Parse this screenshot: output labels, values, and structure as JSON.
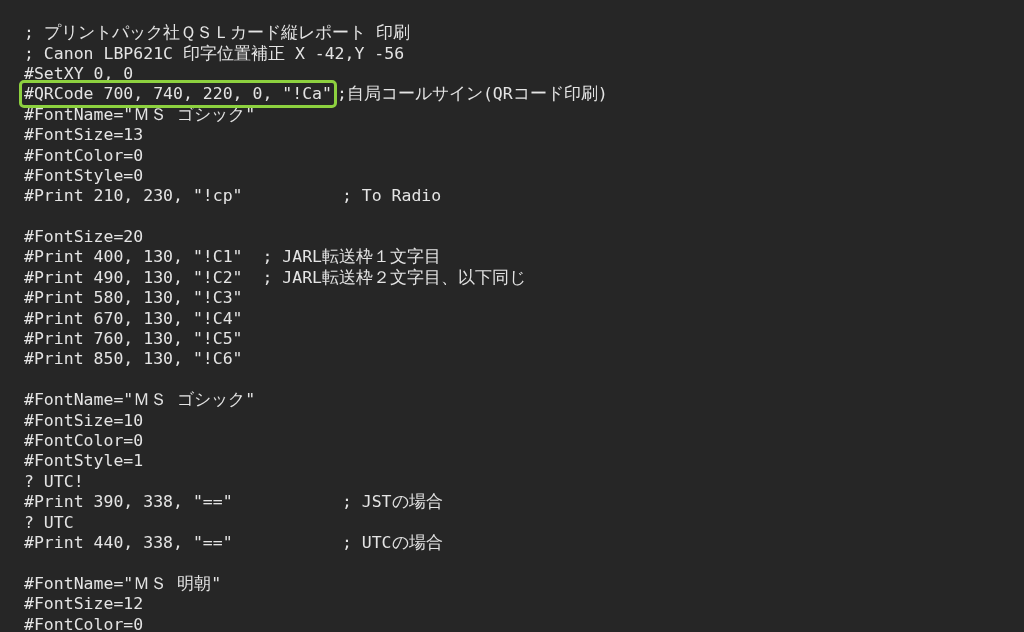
{
  "editor": {
    "lines": [
      {
        "kind": "code",
        "text": "; プリントパック社ＱＳＬカード縦レポート 印刷"
      },
      {
        "kind": "code",
        "text": "; Canon LBP621C 印字位置補正 X -42,Y -56"
      },
      {
        "kind": "code",
        "text": "#SetXY 0, 0"
      },
      {
        "kind": "boxed",
        "text": "#QRCode 700, 740, 220, 0, \"!Ca\"",
        "comment": ";自局コールサイン(QRコード印刷)"
      },
      {
        "kind": "code",
        "text": "#FontName=\"ＭＳ ゴシック\""
      },
      {
        "kind": "code",
        "text": "#FontSize=13"
      },
      {
        "kind": "code",
        "text": "#FontColor=0"
      },
      {
        "kind": "code",
        "text": "#FontStyle=0"
      },
      {
        "kind": "code",
        "text": "#Print 210, 230, \"!cp\"          ; To Radio"
      },
      {
        "kind": "blank"
      },
      {
        "kind": "code",
        "text": "#FontSize=20"
      },
      {
        "kind": "code",
        "text": "#Print 400, 130, \"!C1\"  ; JARL転送枠１文字目"
      },
      {
        "kind": "code",
        "text": "#Print 490, 130, \"!C2\"  ; JARL転送枠２文字目、以下同じ"
      },
      {
        "kind": "code",
        "text": "#Print 580, 130, \"!C3\""
      },
      {
        "kind": "code",
        "text": "#Print 670, 130, \"!C4\""
      },
      {
        "kind": "code",
        "text": "#Print 760, 130, \"!C5\""
      },
      {
        "kind": "code",
        "text": "#Print 850, 130, \"!C6\""
      },
      {
        "kind": "blank"
      },
      {
        "kind": "code",
        "text": "#FontName=\"ＭＳ ゴシック\""
      },
      {
        "kind": "code",
        "text": "#FontSize=10"
      },
      {
        "kind": "code",
        "text": "#FontColor=0"
      },
      {
        "kind": "code",
        "text": "#FontStyle=1"
      },
      {
        "kind": "code",
        "text": "? UTC!"
      },
      {
        "kind": "code",
        "text": "#Print 390, 338, \"==\"           ; JSTの場合"
      },
      {
        "kind": "code",
        "text": "? UTC"
      },
      {
        "kind": "code",
        "text": "#Print 440, 338, \"==\"           ; UTCの場合"
      },
      {
        "kind": "blank"
      },
      {
        "kind": "code",
        "text": "#FontName=\"ＭＳ 明朝\""
      },
      {
        "kind": "code",
        "text": "#FontSize=12"
      },
      {
        "kind": "code",
        "text": "#FontColor=0"
      }
    ]
  }
}
